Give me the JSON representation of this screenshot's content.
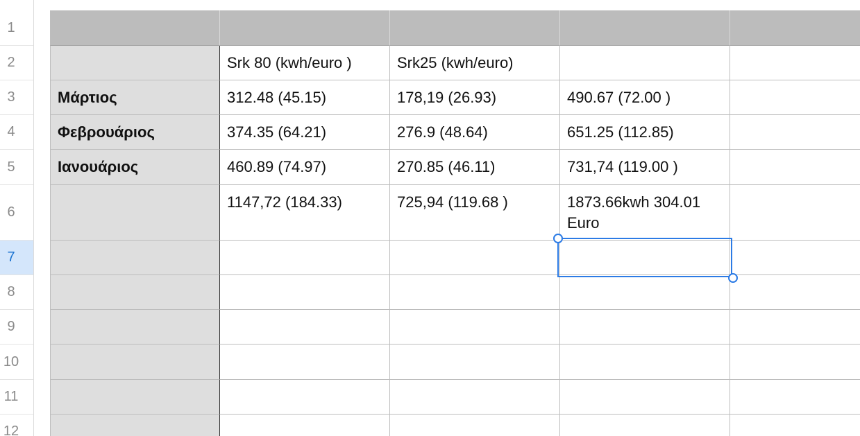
{
  "row_numbers": [
    "1",
    "2",
    "3",
    "4",
    "5",
    "6",
    "7",
    "8",
    "9",
    "10",
    "11",
    "12"
  ],
  "selected_row": "7",
  "table": {
    "header_row": [
      "",
      "",
      "",
      "",
      ""
    ],
    "column_titles": [
      "",
      "Srk 80 (kwh/euro )",
      "Srk25 (kwh/euro)",
      "",
      ""
    ],
    "rows": [
      [
        "Μάρτιος",
        "312.48 (45.15)",
        "178,19 (26.93)",
        "490.67 (72.00 )",
        ""
      ],
      [
        "Φεβρουάριος",
        "374.35 (64.21)",
        "276.9 (48.64)",
        "651.25 (112.85)",
        ""
      ],
      [
        "Ιανουάριος",
        "460.89 (74.97)",
        "270.85 (46.11)",
        "731,74 (119.00 )",
        ""
      ],
      [
        "",
        "1147,72 (184.33)",
        "725,94 (119.68 )",
        "1873.66kwh 304.01 Euro",
        ""
      ],
      [
        "",
        "",
        "",
        "",
        ""
      ],
      [
        "",
        "",
        "",
        "",
        ""
      ],
      [
        "",
        "",
        "",
        "",
        ""
      ],
      [
        "",
        "",
        "",
        "",
        ""
      ],
      [
        "",
        "",
        "",
        "",
        ""
      ],
      [
        "",
        "",
        "",
        "",
        ""
      ]
    ]
  },
  "colors": {
    "header_bg": "#bcbcbc",
    "label_col_bg": "#dedede",
    "selection": "#2c7be5",
    "selected_row_bg": "#d4e6fb"
  }
}
